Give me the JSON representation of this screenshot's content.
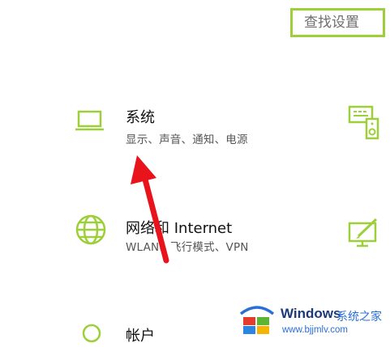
{
  "search": {
    "placeholder": "查找设置"
  },
  "tiles": [
    {
      "title": "系统",
      "description": "显示、声音、通知、电源",
      "icon": "laptop-icon"
    },
    {
      "title": "网络和 Internet",
      "description": "WLAN、飞行模式、VPN",
      "icon": "globe-icon"
    },
    {
      "title": "帐户",
      "description": "",
      "icon": "account-icon"
    },
    {
      "icon": "keyboard-speaker-icon"
    },
    {
      "icon": "display-pen-icon"
    }
  ],
  "annotation": {
    "icon": "red-arrow-icon",
    "color": "#e8131b"
  },
  "watermark": {
    "brand": "Windows",
    "cn": "系统之家",
    "url": "www.bjjmlv.com",
    "icon": "windows-logo-icon"
  },
  "colors": {
    "accent": "#9ccf3a",
    "arrow": "#e8131b",
    "watermark_blue": "#2a6fd8"
  }
}
